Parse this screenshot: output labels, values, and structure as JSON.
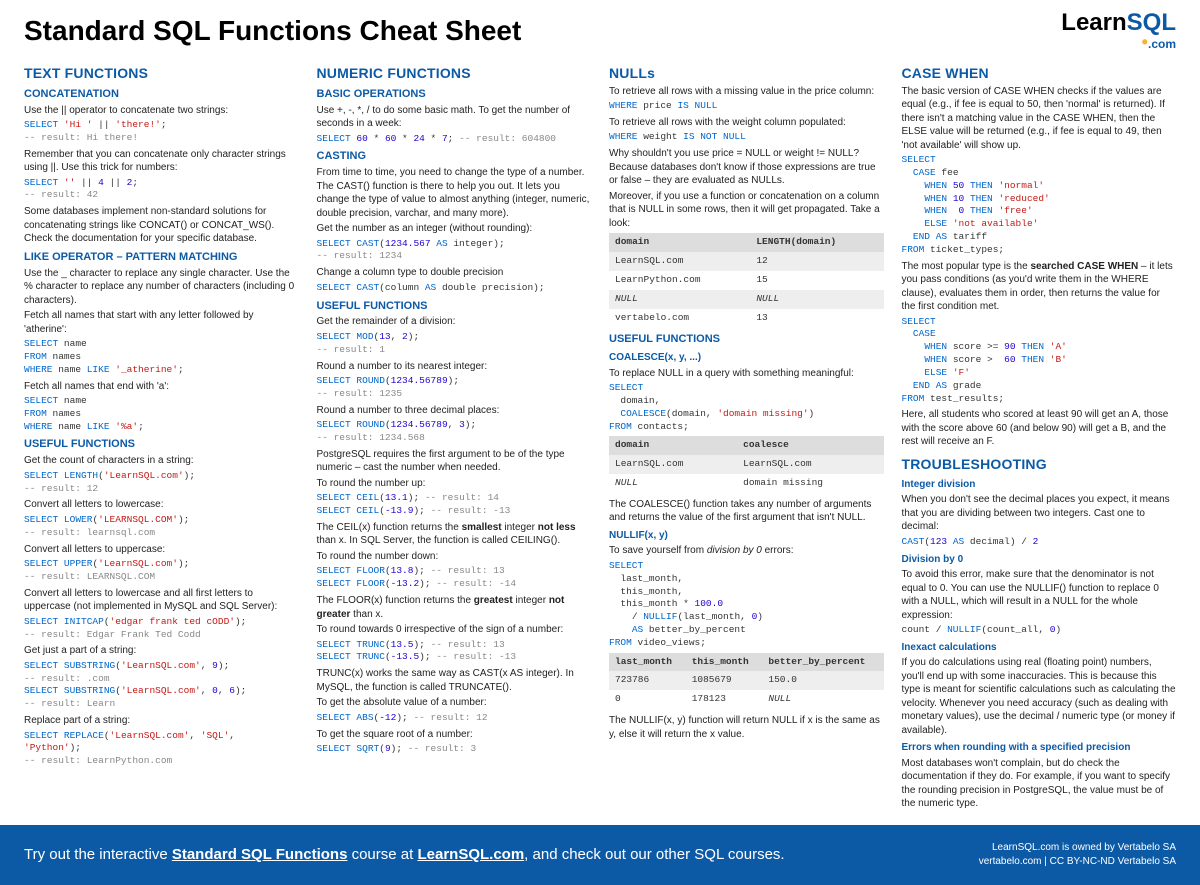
{
  "header": {
    "title": "Standard SQL Functions Cheat Sheet",
    "logo_learn": "Learn",
    "logo_sql": "SQL",
    "logo_com": ".com"
  },
  "col1": {
    "h_text": "TEXT FUNCTIONS",
    "h_concat": "CONCATENATION",
    "concat_p1": "Use the || operator to concatenate two strings:",
    "concat_p2": "Remember that you can concatenate only character strings using ||. Use this trick for numbers:",
    "concat_p3": "Some databases implement non-standard solutions for concatenating strings like CONCAT() or CONCAT_WS(). Check the documentation for your specific database.",
    "h_like": "LIKE OPERATOR – PATTERN MATCHING",
    "like_p1": "Use the _ character to replace any single character. Use the % character to replace any number of characters (including 0 characters).",
    "like_p2": "Fetch all names that start with any letter followed by 'atherine':",
    "like_p3": "Fetch all names that end with 'a':",
    "h_useful": "USEFUL FUNCTIONS",
    "uf_p1": "Get the count of characters in a string:",
    "uf_p2": "Convert all letters to lowercase:",
    "uf_p3": "Convert all letters to uppercase:",
    "uf_p4": "Convert all letters to lowercase and all first letters to uppercase (not implemented in MySQL and SQL Server):",
    "uf_p5": "Get just a part of a string:",
    "uf_p6": "Replace part of a string:"
  },
  "col2": {
    "h_num": "NUMERIC FUNCTIONS",
    "h_basic": "BASIC OPERATIONS",
    "basic_p1": "Use +, -, *, / to do some basic math. To get the number of seconds in a week:",
    "h_cast": "CASTING",
    "cast_p1": "From time to time, you need to change the type of a number. The CAST() function is there to help you out. It lets you change the type of value to almost anything (integer, numeric, double precision, varchar, and many more).",
    "cast_p2": "Get the number as an integer (without rounding):",
    "cast_p3": "Change a column type to double precision",
    "h_useful": "USEFUL FUNCTIONS",
    "uf_p1": "Get the remainder of a division:",
    "uf_p2": "Round a number to its nearest integer:",
    "uf_p3": "Round a number to three decimal places:",
    "uf_p4": "PostgreSQL requires the first argument to be of the type numeric – cast the number when needed.",
    "uf_p5": "To round the number up:",
    "uf_p6a": "The CEIL(x) function returns the ",
    "uf_p6b": "smallest",
    "uf_p6c": " integer ",
    "uf_p6d": "not less",
    "uf_p6e": " than x. In SQL Server, the function is called CEILING().",
    "uf_p7": "To round the number down:",
    "uf_p8a": "The FLOOR(x) function returns the ",
    "uf_p8b": "greatest",
    "uf_p8c": " integer ",
    "uf_p8d": "not greater",
    "uf_p8e": " than x.",
    "uf_p9": "To round towards 0 irrespective of the sign of a number:",
    "uf_p10": "TRUNC(x) works the same way as CAST(x AS integer). In MySQL, the function is called TRUNCATE().",
    "uf_p11": "To get the absolute value of a number:",
    "uf_p12": "To get the square root of a number:"
  },
  "col3": {
    "h_nulls": "NULLs",
    "nulls_p1": "To retrieve all rows with a missing value in the price column:",
    "nulls_p2": "To retrieve all rows with the weight column populated:",
    "nulls_p3": "Why shouldn't you use price = NULL or weight != NULL? Because databases don't know if those expressions are true or false – they are evaluated as NULLs.",
    "nulls_p4": "Moreover, if you use a function or concatenation on a column that is NULL in some rows, then it will get propagated. Take a look:",
    "table1_headers": [
      "domain",
      "LENGTH(domain)"
    ],
    "table1_rows": [
      [
        "LearnSQL.com",
        "12"
      ],
      [
        "LearnPython.com",
        "15"
      ],
      [
        "NULL",
        "NULL"
      ],
      [
        "vertabelo.com",
        "13"
      ]
    ],
    "h_useful": "USEFUL FUNCTIONS",
    "h_coalesce": "COALESCE(x, y, ...)",
    "coal_p1": "To replace NULL in a query with something meaningful:",
    "table2_headers": [
      "domain",
      "coalesce"
    ],
    "table2_rows": [
      [
        "LearnSQL.com",
        "LearnSQL.com"
      ],
      [
        "NULL",
        "domain missing"
      ]
    ],
    "coal_p2": "The COALESCE() function takes any number of arguments and returns the value of the first argument that isn't NULL.",
    "h_nullif": "NULLIF(x, y)",
    "nullif_p1": "To save yourself from division by 0 errors:",
    "table3_headers": [
      "last_month",
      "this_month",
      "better_by_percent"
    ],
    "table3_rows": [
      [
        "723786",
        "1085679",
        "150.0"
      ],
      [
        "0",
        "178123",
        "NULL"
      ]
    ],
    "nullif_p2": "The NULLIF(x, y) function will return NULL if x is the same as y, else it will return the x value."
  },
  "col4": {
    "h_case": "CASE WHEN",
    "case_p1": "The basic version of CASE WHEN checks if the values are equal (e.g., if fee is equal to 50, then 'normal' is returned). If there isn't a matching value in the CASE WHEN, then the ELSE value will be returned (e.g., if fee is equal to 49, then 'not available' will show up.",
    "case_p2a": "The most popular type is the ",
    "case_p2b": "searched CASE WHEN",
    "case_p2c": " – it lets you pass conditions (as you'd write them in the WHERE clause), evaluates them in order, then returns the value for the first condition met.",
    "case_p3": "Here, all students who scored at least 90 will get an A, those with the score above 60 (and below 90) will get a B, and the rest will receive an F.",
    "h_trouble": "TROUBLESHOOTING",
    "t1_h": "Integer division",
    "t1_p": "When you don't see the decimal places you expect, it means that you are dividing between two integers. Cast one to decimal:",
    "t2_h": "Division by 0",
    "t2_p": "To avoid this error, make sure that the denominator is not equal to 0. You can use the NULLIF() function to replace 0 with a NULL, which will result in a NULL for the whole expression:",
    "t3_h": "Inexact calculations",
    "t3_p": "If you do calculations using real (floating point) numbers, you'll end up with some inaccuracies. This is because this type is meant for scientific calculations such as calculating the velocity. Whenever you need accuracy (such as dealing with monetary values), use the decimal / numeric type (or money if available).",
    "t4_h": "Errors when rounding with a specified precision",
    "t4_p": "Most databases won't complain, but do check the documentation if they do. For example, if you want to specify the rounding precision in PostgreSQL, the value must be of the numeric type."
  },
  "footer": {
    "left_a": "Try out the interactive ",
    "left_link1": "Standard SQL Functions",
    "left_b": " course at ",
    "left_link2": "LearnSQL.com",
    "left_c": ", and check out our other SQL courses.",
    "right_1": "LearnSQL.com is owned by Vertabelo SA",
    "right_2": "vertabelo.com | CC BY-NC-ND Vertabelo SA"
  }
}
